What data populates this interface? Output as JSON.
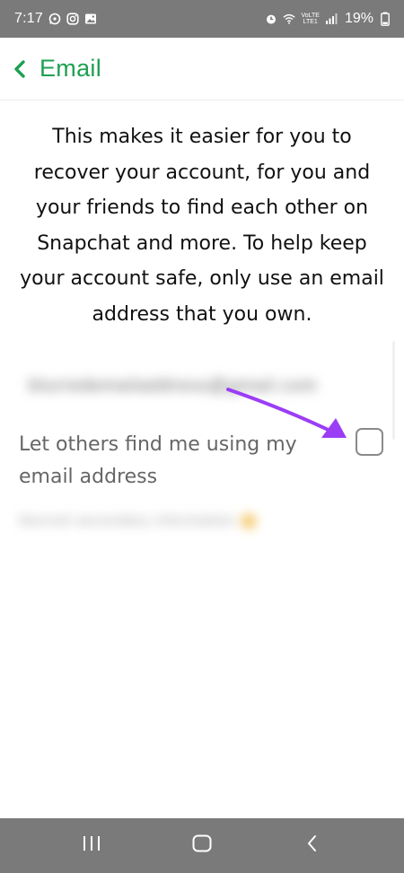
{
  "status_bar": {
    "time": "7:17",
    "lte_top": "VoLTE",
    "lte_bottom": "LTE1",
    "battery": "19%"
  },
  "header": {
    "title": "Email"
  },
  "description": "This makes it easier for you to recover your account, for you and your friends to find each other on Snapchat and more. To help keep your account safe, only use an email address that you own.",
  "email": {
    "value": "blurredemailaddress@gmail.com"
  },
  "option": {
    "label": "Let others find me using my email address",
    "checked": false
  },
  "secondary": {
    "value": "blurred secondary information"
  },
  "colors": {
    "accent": "#1ea052",
    "arrow": "#9b3df5",
    "status_bar": "#7a7a7a"
  },
  "icons": {
    "back": "chevron-left-icon",
    "whatsapp": "whatsapp-icon",
    "instagram": "instagram-icon",
    "gallery": "gallery-icon",
    "alarm": "alarm-icon",
    "wifi": "wifi-icon",
    "signal": "signal-icon",
    "battery": "battery-icon",
    "recents": "recents-icon",
    "home": "home-icon",
    "nav_back": "nav-back-icon"
  }
}
